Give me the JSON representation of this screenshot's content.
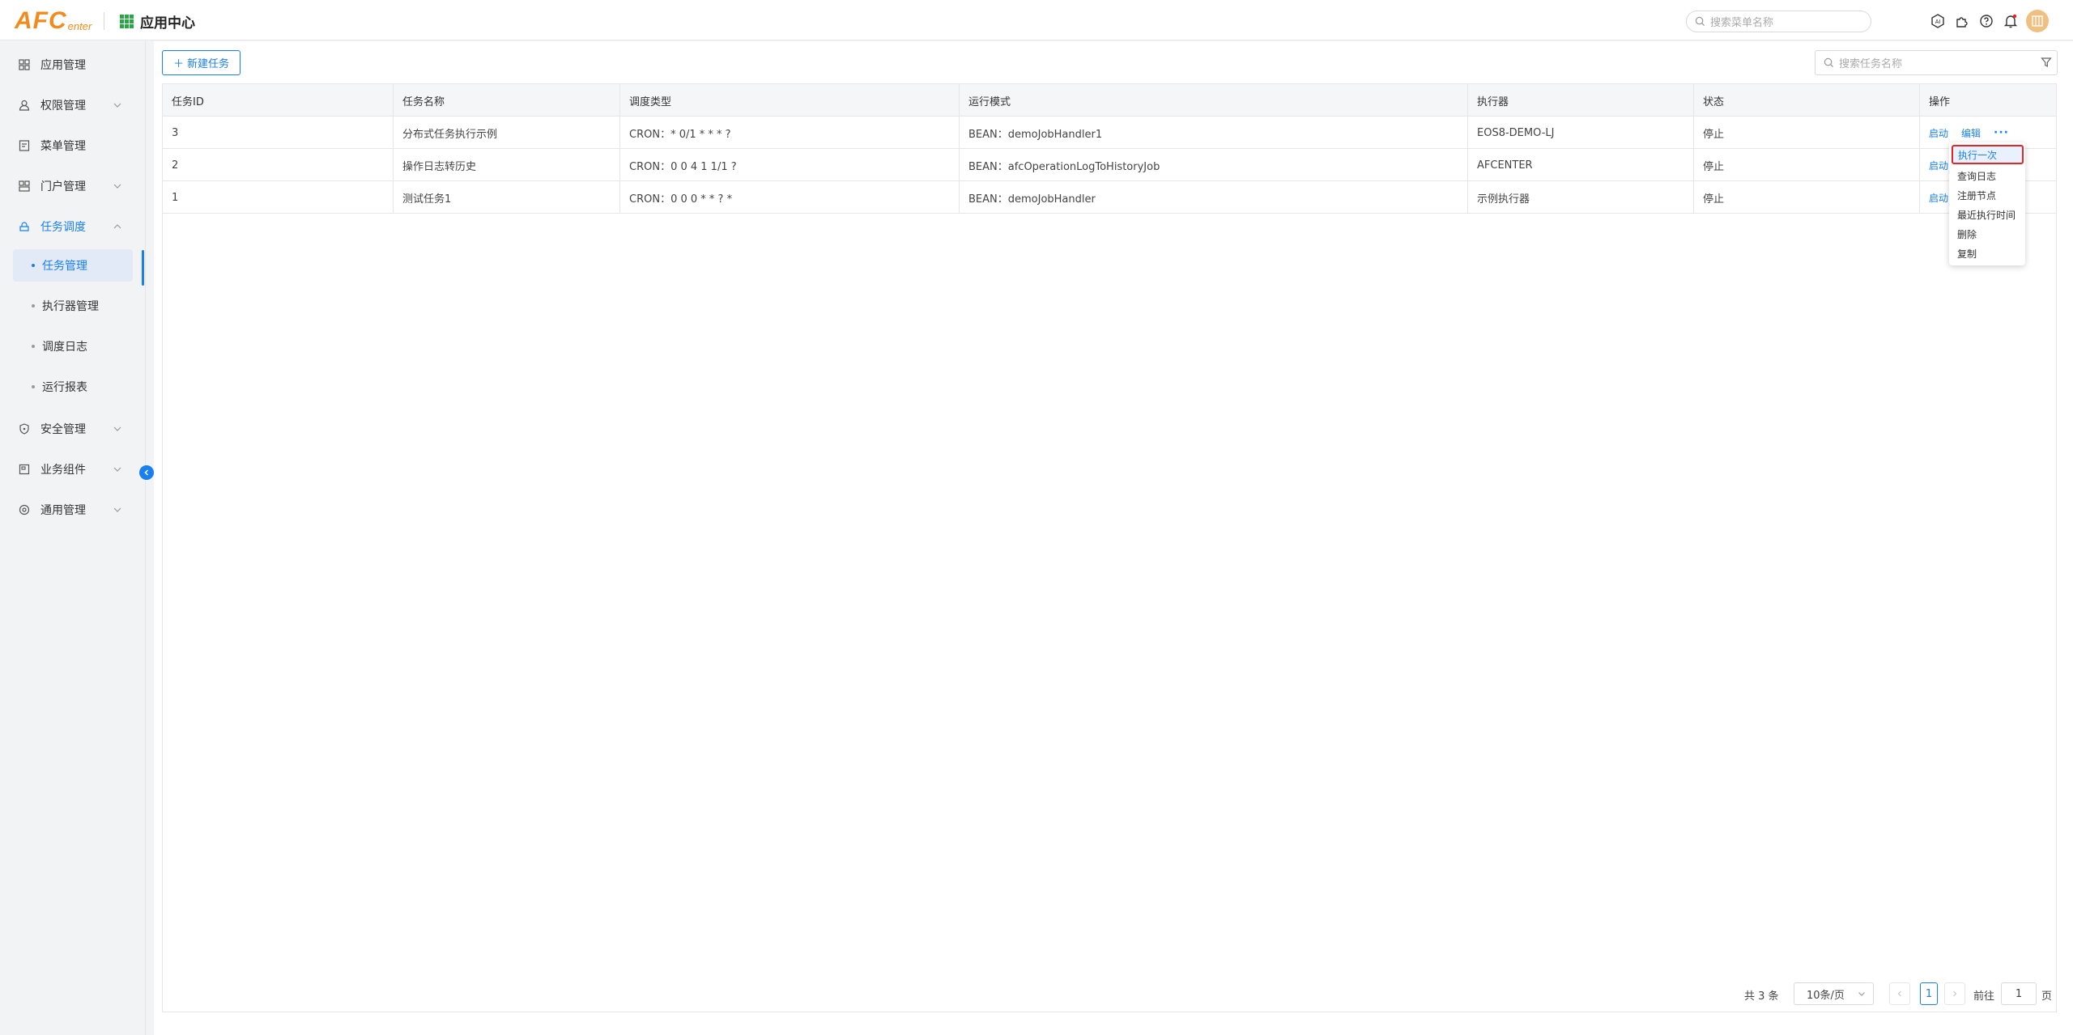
{
  "header": {
    "logo_big": "AFC",
    "logo_small": "enter",
    "app_title": "应用中心",
    "search_placeholder": "搜索菜单名称"
  },
  "sidebar": {
    "items": [
      {
        "label": "应用管理",
        "icon": "apps-icon"
      },
      {
        "label": "权限管理",
        "icon": "user-lock-icon"
      },
      {
        "label": "菜单管理",
        "icon": "menu-doc-icon"
      },
      {
        "label": "门户管理",
        "icon": "portal-icon"
      },
      {
        "label": "任务调度",
        "icon": "schedule-icon"
      },
      {
        "label": "安全管理",
        "icon": "shield-icon"
      },
      {
        "label": "业务组件",
        "icon": "component-icon"
      },
      {
        "label": "通用管理",
        "icon": "settings-icon"
      }
    ],
    "sub_items": [
      {
        "label": "任务管理"
      },
      {
        "label": "执行器管理"
      },
      {
        "label": "调度日志"
      },
      {
        "label": "运行报表"
      }
    ]
  },
  "toolbar": {
    "new_task_label": "新建任务",
    "search_placeholder": "搜索任务名称"
  },
  "table": {
    "columns": [
      "任务ID",
      "任务名称",
      "调度类型",
      "运行模式",
      "执行器",
      "状态",
      "操作"
    ],
    "rows": [
      {
        "id": "3",
        "name": "分布式任务执行示例",
        "schedule": "CRON：* 0/1 * * * ?",
        "mode": "BEAN：demoJobHandler1",
        "executor": "EOS8-DEMO-LJ",
        "status": "停止",
        "op_start": "启动",
        "op_edit": "编辑",
        "op_more": "···"
      },
      {
        "id": "2",
        "name": "操作日志转历史",
        "schedule": "CRON：0 0 4 1 1/1 ?",
        "mode": "BEAN：afcOperationLogToHistoryJob",
        "executor": "AFCENTER",
        "status": "停止",
        "op_start": "启动"
      },
      {
        "id": "1",
        "name": "测试任务1",
        "schedule": "CRON：0 0 0 * * ? *",
        "mode": "BEAN：demoJobHandler",
        "executor": "示例执行器",
        "status": "停止",
        "op_start": "启动"
      }
    ]
  },
  "dropdown": {
    "items": [
      "执行一次",
      "查询日志",
      "注册节点",
      "最近执行时间",
      "删除",
      "复制"
    ]
  },
  "pagination": {
    "total": "共 3 条",
    "page_size": "10条/页",
    "current_page": "1",
    "goto_label": "前往",
    "goto_value": "1",
    "page_suffix": "页"
  },
  "colors": {
    "accent": "#1a7ff0",
    "logo": "#f08c1e",
    "highlight_border": "#e32626"
  }
}
